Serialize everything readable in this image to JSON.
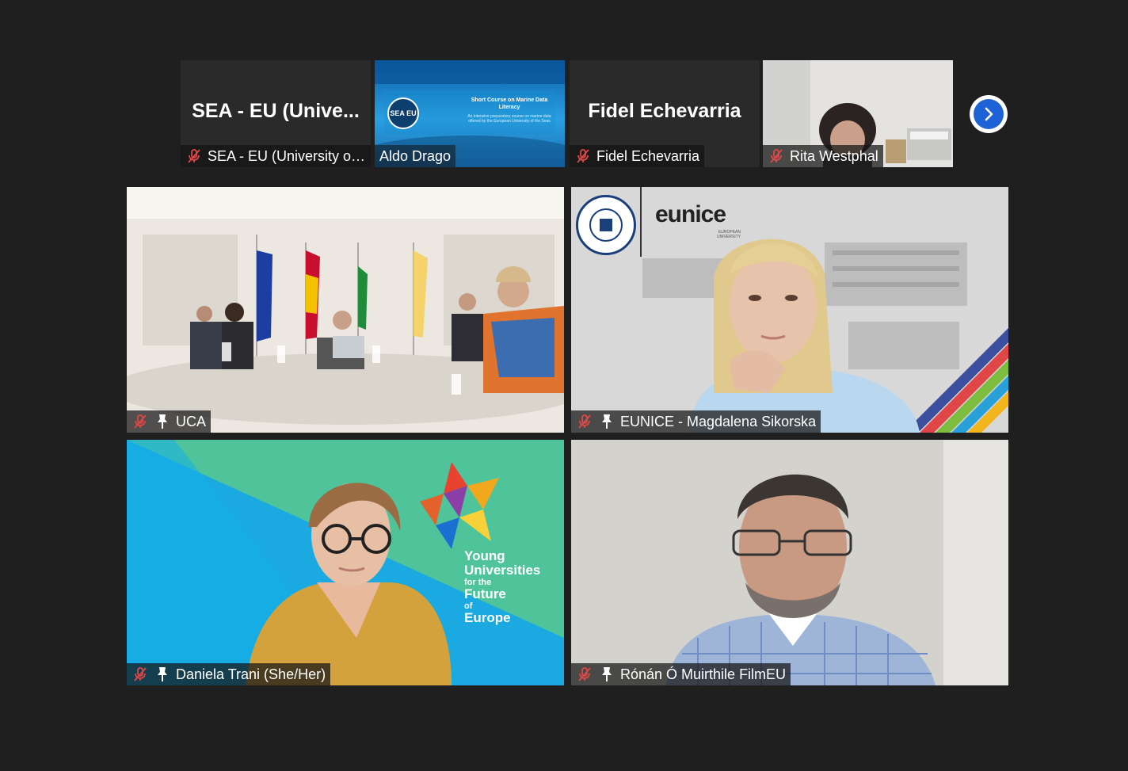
{
  "strip": {
    "tiles": [
      {
        "big_name": "SEA - EU (Unive...",
        "label": "SEA - EU (University of...",
        "muted": true
      },
      {
        "label": "Aldo Drago",
        "muted": false,
        "slide": {
          "logo": "SEA EU",
          "heading": "Short Course on Marine Data Literacy",
          "subtitle": "An intensive preparatory course on marine data offered by the European University of the Seas"
        }
      },
      {
        "big_name": "Fidel Echevarria",
        "label": "Fidel Echevarria",
        "muted": true
      },
      {
        "label": "Rita Westphal",
        "muted": true
      }
    ],
    "next_icon": "chevron-right-icon"
  },
  "videos": [
    {
      "label": "UCA",
      "muted": true,
      "pinned": true
    },
    {
      "label": "EUNICE - Magdalena Sikorska",
      "muted": true,
      "pinned": true,
      "brand": "eunice",
      "brand_sub": "EUROPEAN UNIVERSITY"
    },
    {
      "label": "Daniela Trani (She/Her)",
      "muted": true,
      "pinned": true,
      "brand_lines": [
        "Young",
        "Universities",
        "for the",
        "Future",
        "of",
        "Europe"
      ]
    },
    {
      "label": "Rónán Ó Muirthile FilmEU",
      "muted": true,
      "pinned": true
    }
  ],
  "colors": {
    "background": "#1f1f1f",
    "accent": "#1e63d6",
    "muted_icon": "#e04848",
    "yufe_teal": "#4fc39a",
    "yufe_blue": "#1aa9e0"
  }
}
